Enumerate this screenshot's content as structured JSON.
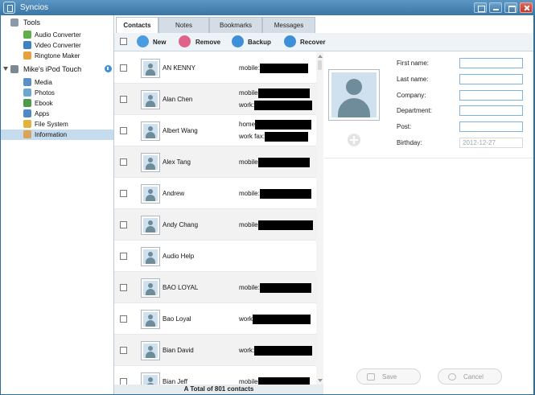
{
  "window": {
    "title": "Syncios"
  },
  "sidebar": {
    "tools_header": "Tools",
    "tools": [
      {
        "label": "Audio Converter",
        "icon": "audio-converter-icon"
      },
      {
        "label": "Video Converter",
        "icon": "video-converter-icon"
      },
      {
        "label": "Ringtone Maker",
        "icon": "ringtone-maker-icon"
      }
    ],
    "device_header": "Mike's iPod Touch",
    "device": [
      {
        "label": "Media",
        "icon": "media-icon"
      },
      {
        "label": "Photos",
        "icon": "photos-icon"
      },
      {
        "label": "Ebook",
        "icon": "ebook-icon"
      },
      {
        "label": "Apps",
        "icon": "apps-icon"
      },
      {
        "label": "File System",
        "icon": "file-system-icon"
      },
      {
        "label": "Information",
        "icon": "information-icon",
        "selected": true
      }
    ]
  },
  "tabs": [
    {
      "label": "Contacts",
      "active": true
    },
    {
      "label": "Notes"
    },
    {
      "label": "Bookmarks"
    },
    {
      "label": "Messages"
    }
  ],
  "toolbar": {
    "new": "New",
    "remove": "Remove",
    "backup": "Backup",
    "recover": "Recover"
  },
  "contacts": [
    {
      "name": "AN KENNY",
      "phones": [
        {
          "label": "mobile:",
          "redacted": true
        }
      ]
    },
    {
      "name": "Alan Chen",
      "phones": [
        {
          "label": "mobile",
          "redacted": true
        },
        {
          "label": "work:",
          "redacted": true
        }
      ]
    },
    {
      "name": "Albert Wang",
      "phones": [
        {
          "label": "home",
          "redacted": true
        },
        {
          "label": "work fax:",
          "redacted": true
        }
      ]
    },
    {
      "name": "Alex Tang",
      "phones": [
        {
          "label": "mobile",
          "redacted": true
        }
      ]
    },
    {
      "name": "Andrew",
      "phones": [
        {
          "label": "mobile:",
          "redacted": true
        }
      ]
    },
    {
      "name": "Andy Chang",
      "phones": [
        {
          "label": "mobile",
          "redacted": true
        }
      ]
    },
    {
      "name": "Audio Help",
      "phones": []
    },
    {
      "name": "BAO LOYAL",
      "phones": [
        {
          "label": "mobile:",
          "redacted": true
        }
      ]
    },
    {
      "name": "Bao Loyal",
      "phones": [
        {
          "label": "work",
          "redacted": true
        }
      ]
    },
    {
      "name": "Bian David",
      "phones": [
        {
          "label": "work:",
          "redacted": true
        }
      ]
    },
    {
      "name": "Bian Jeff",
      "phones": [
        {
          "label": "mobile",
          "redacted": true
        }
      ]
    }
  ],
  "footer": {
    "total": "A Total of 801 contacts"
  },
  "detail": {
    "fields": [
      {
        "label": "First name:",
        "value": ""
      },
      {
        "label": "Last name:",
        "value": ""
      },
      {
        "label": "Company:",
        "value": ""
      },
      {
        "label": "Department:",
        "value": ""
      },
      {
        "label": "Post:",
        "value": ""
      },
      {
        "label": "Birthday:",
        "value": "2012-12-27",
        "readonly": true
      }
    ],
    "save": "Save",
    "cancel": "Cancel"
  },
  "colors": {
    "accent": "#3a76a6",
    "new_button": "#4a9be0",
    "remove_button": "#e0618a",
    "backup_button": "#3d8fd8",
    "recover_button": "#3d8fd8",
    "selected_row": "#c5dcef"
  }
}
